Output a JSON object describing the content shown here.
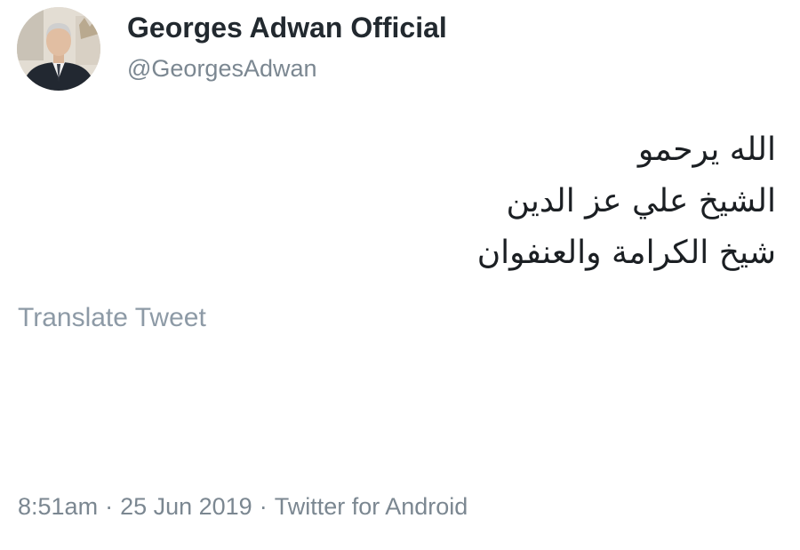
{
  "author": {
    "display_name": "Georges Adwan Official",
    "handle": "@GeorgesAdwan",
    "avatar_icon": "user-avatar-photo"
  },
  "tweet": {
    "lines": [
      "الله يرحمو",
      "الشيخ علي عز الدين",
      "شيخ الكرامة والعنفوان"
    ],
    "translate_label": "Translate Tweet"
  },
  "meta": {
    "time": "8:51am",
    "separator": "·",
    "date": "25 Jun 2019",
    "source": "Twitter for Android"
  },
  "colors": {
    "name": "#22292f",
    "secondary": "#7b8791",
    "translate": "#8d9aa6",
    "background": "#ffffff"
  }
}
